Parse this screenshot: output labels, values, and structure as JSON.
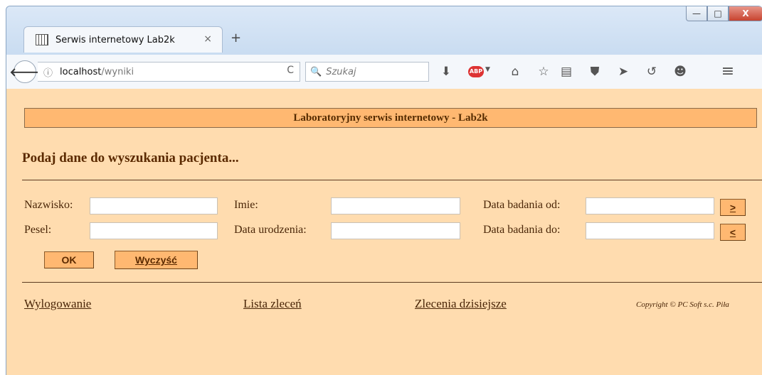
{
  "browser": {
    "tab_title": "Serwis internetowy Lab2k",
    "tab_close": "×",
    "new_tab": "+",
    "url_host": "localhost",
    "url_path": "/wyniki",
    "search_placeholder": "Szukaj",
    "icons": {
      "back": "🡐",
      "info": "ⓘ",
      "reload": "C",
      "search": "🔍",
      "download": "⬇",
      "abp": "ABP",
      "home": "⌂",
      "star": "☆",
      "reader": "▤",
      "pocket": "⛊",
      "send": "➤",
      "history": "↺",
      "smile": "☻",
      "menu": "≡"
    },
    "window_buttons": {
      "minimize": "—",
      "maximize": "□",
      "close": "X"
    }
  },
  "page": {
    "banner": "Laboratoryjny serwis internetowy - Lab2k",
    "section_title": "Podaj dane do wyszukania pacjenta...",
    "form": {
      "nazwisko_label": "Nazwisko:",
      "imie_label": "Imie:",
      "data_od_label": "Data badania od:",
      "pesel_label": "Pesel:",
      "data_urodzenia_label": "Data urodzenia:",
      "data_do_label": "Data badania do:",
      "ge_button": ">",
      "le_button": "<",
      "ok_button": "OK",
      "clear_button": "Wyczyść"
    },
    "footer": {
      "logout": "Wylogowanie",
      "orders": "Lista zleceń",
      "today_orders": "Zlecenia dzisiejsze",
      "copyright": "Copyright ©  PC Soft s.c. Piła"
    }
  },
  "colors": {
    "page_bg": "#ffdcaf",
    "banner_bg": "#ffb871",
    "text_brown": "#5b2a00"
  }
}
